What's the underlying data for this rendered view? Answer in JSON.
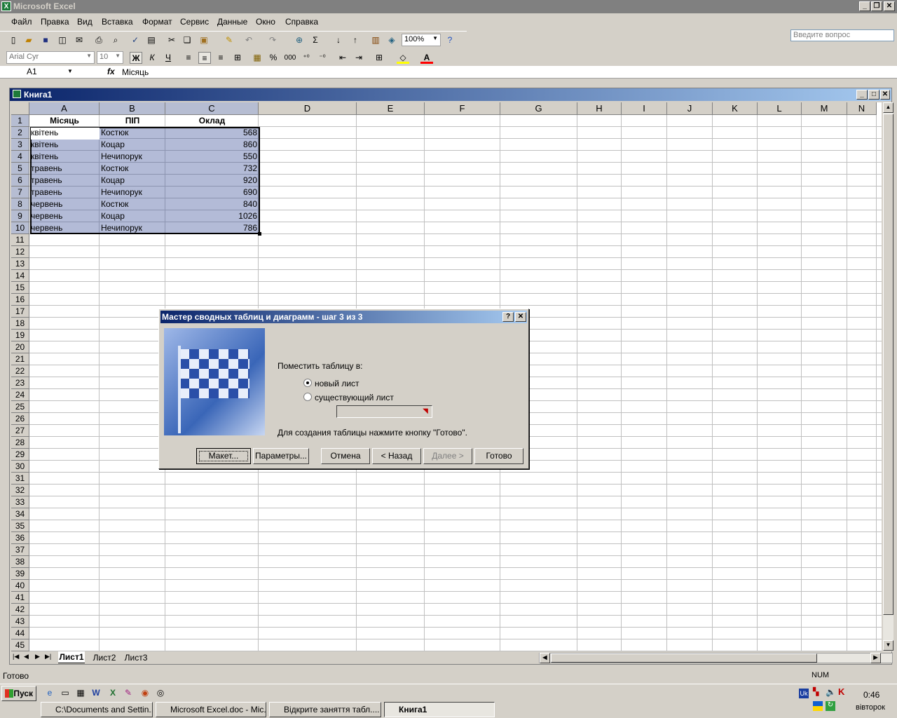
{
  "app": {
    "title": "Microsoft Excel"
  },
  "menu": [
    "Файл",
    "Правка",
    "Вид",
    "Вставка",
    "Формат",
    "Сервис",
    "Данные",
    "Окно",
    "Справка"
  ],
  "ask_placeholder": "Введите вопрос",
  "toolbar": {
    "zoom": "100%",
    "font": "Arial Cyr",
    "size": "10",
    "bold": "Ж",
    "italic": "К",
    "underline": "Ч",
    "percent": "%",
    "thousands": "000"
  },
  "formula_bar": {
    "cell_ref": "A1",
    "fx": "fx",
    "value": "Місяць"
  },
  "workbook": {
    "title": "Книга1"
  },
  "columns": [
    "A",
    "B",
    "C",
    "D",
    "E",
    "F",
    "G",
    "H",
    "I",
    "J",
    "K",
    "L",
    "M",
    "N"
  ],
  "table": {
    "headers": [
      "Місяць",
      "ПІП",
      "Оклад"
    ],
    "rows": [
      [
        "квітень",
        "Костюк",
        "568"
      ],
      [
        "квітень",
        "Коцар",
        "860"
      ],
      [
        "квітень",
        "Нечипорук",
        "550"
      ],
      [
        "травень",
        "Костюк",
        "732"
      ],
      [
        "травень",
        "Коцар",
        "920"
      ],
      [
        "травень",
        "Нечипорук",
        "690"
      ],
      [
        "червень",
        "Костюк",
        "840"
      ],
      [
        "червень",
        "Коцар",
        "1026"
      ],
      [
        "червень",
        "Нечипорук",
        "786"
      ]
    ]
  },
  "sheets": [
    "Лист1",
    "Лист2",
    "Лист3"
  ],
  "dialog": {
    "title": "Мастер сводных таблиц и диаграмм - шаг 3 из 3",
    "place_label": "Поместить таблицу в:",
    "opt_new": "новый лист",
    "opt_existing": "существующий лист",
    "hint": "Для создания таблицы нажмите кнопку \"Готово\".",
    "buttons": {
      "layout": "Макет...",
      "params": "Параметры...",
      "cancel": "Отмена",
      "back": "< Назад",
      "next": "Далее >",
      "finish": "Готово"
    }
  },
  "status": {
    "text": "Готово",
    "num": "NUM"
  },
  "taskbar": {
    "start": "Пуск",
    "tasks": [
      "C:\\Documents and Settin...",
      "Microsoft Excel.doc - Mic...",
      "Відкрите заняття табл....",
      "Книга1"
    ],
    "lang": "Uk",
    "time": "0:46",
    "day": "вівторок"
  }
}
